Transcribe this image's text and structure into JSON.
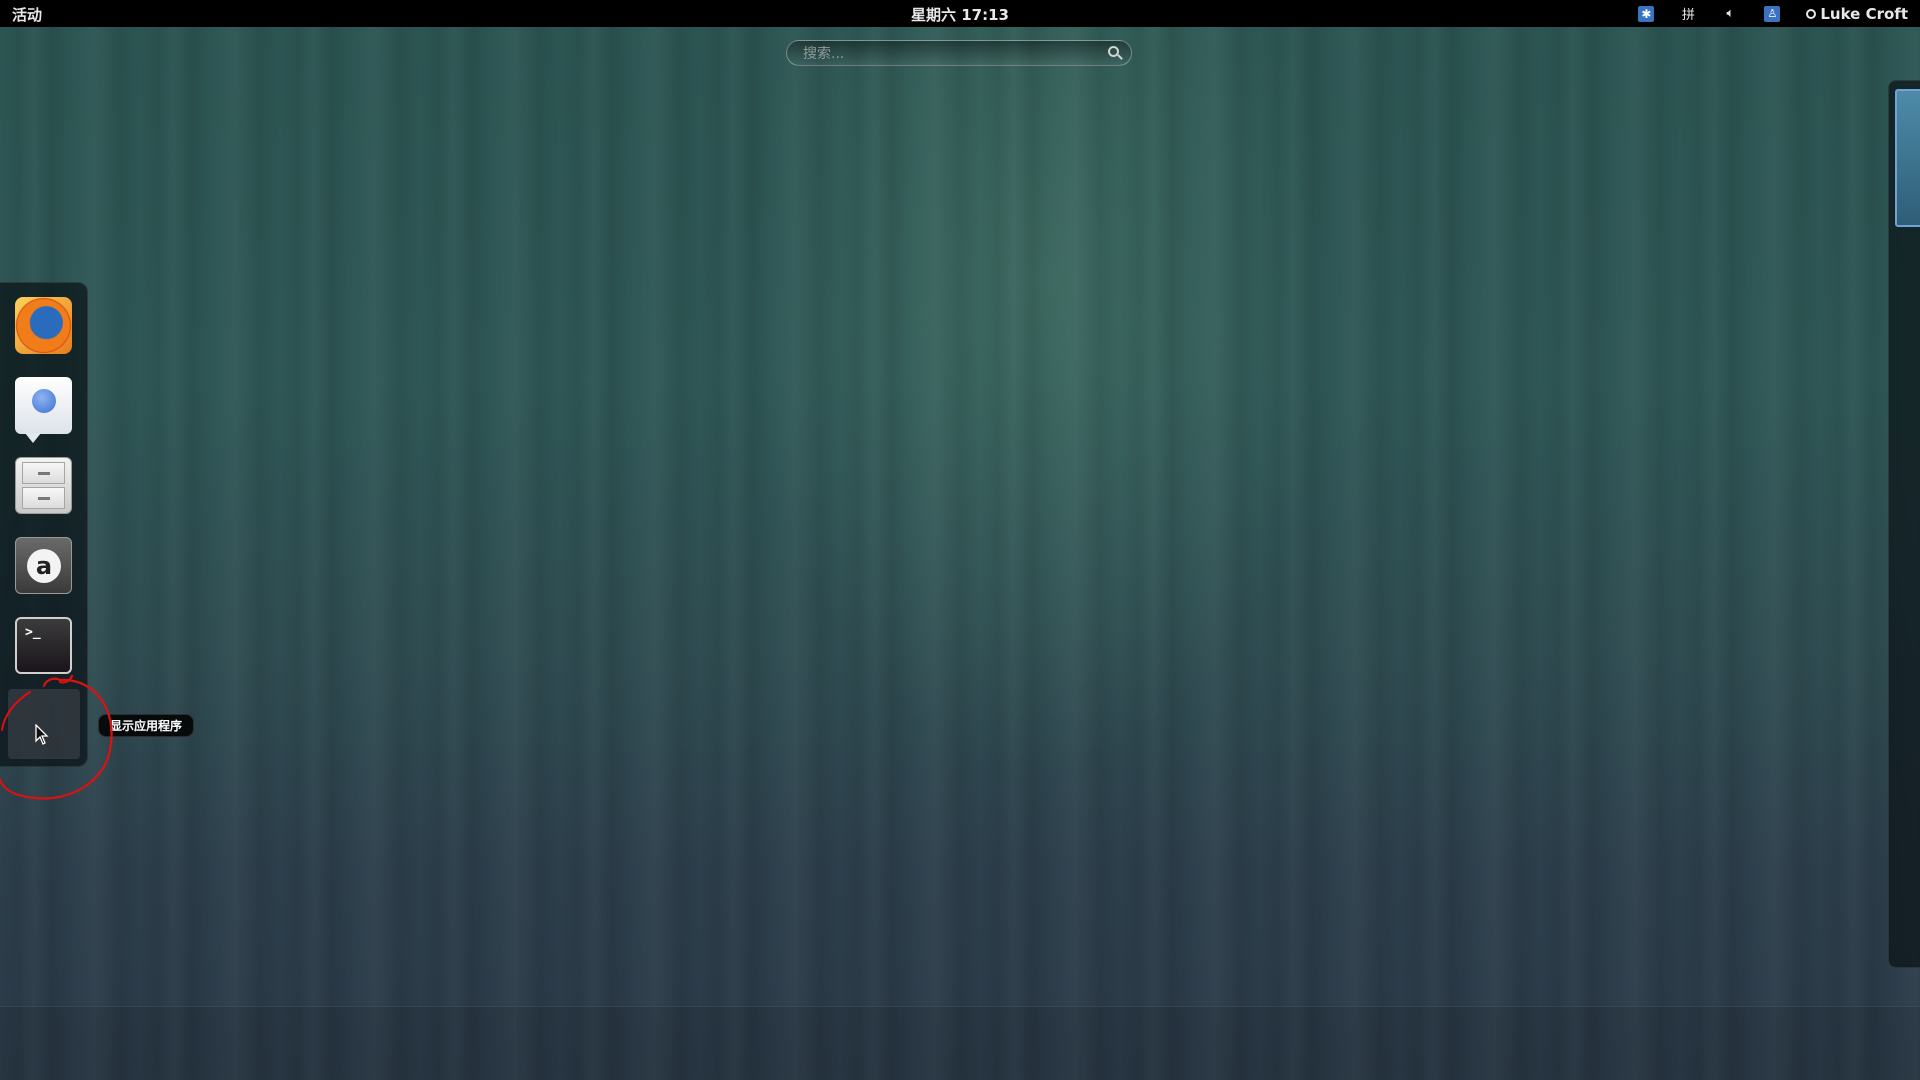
{
  "topbar": {
    "activities_label": "活动",
    "clock": "星期六 17:13",
    "tray": {
      "accessibility_icon": "accessibility-icon",
      "input_method_label": "拼",
      "volume_icon": "volume-icon",
      "status_icon": "status-icon",
      "user_name": "Luke Croft"
    }
  },
  "search": {
    "placeholder": "搜索..."
  },
  "dash": {
    "items": [
      {
        "name": "firefox",
        "icon": "firefox-icon"
      },
      {
        "name": "empathy",
        "icon": "chat-icon"
      },
      {
        "name": "files",
        "icon": "filing-cabinet-icon"
      },
      {
        "name": "software-center",
        "icon": "software-center-icon",
        "glyph": "a"
      },
      {
        "name": "terminal",
        "icon": "terminal-icon",
        "glyph": ">_"
      }
    ],
    "show_apps_tooltip": "显示应用程序"
  },
  "colors": {
    "topbar_bg": "#000000",
    "annotation": "#e01010",
    "workspace_highlight": "#6fa3d8"
  }
}
